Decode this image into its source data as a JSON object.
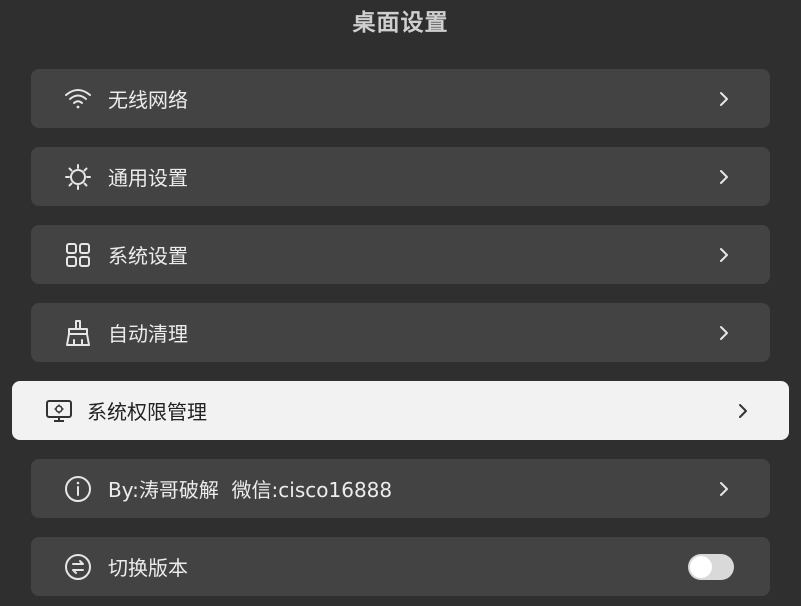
{
  "header": {
    "title": "桌面设置"
  },
  "menu": {
    "items": [
      {
        "label": "无线网络",
        "icon": "wifi-icon"
      },
      {
        "label": "通用设置",
        "icon": "sun-icon"
      },
      {
        "label": "系统设置",
        "icon": "grid-apps-icon"
      },
      {
        "label": "自动清理",
        "icon": "broom-icon"
      },
      {
        "label": "系统权限管理",
        "icon": "monitor-gear-icon",
        "selected": true
      },
      {
        "label": "By:涛哥破解  微信:cisco16888",
        "icon": "info-icon"
      },
      {
        "label": "切换版本",
        "icon": "switch-circle-icon",
        "toggle": false
      }
    ]
  },
  "colors": {
    "background": "#2f2f2f",
    "row": "#434343",
    "row_selected": "#f2f2f2",
    "text": "#ececec",
    "title": "#cfcfcf"
  }
}
